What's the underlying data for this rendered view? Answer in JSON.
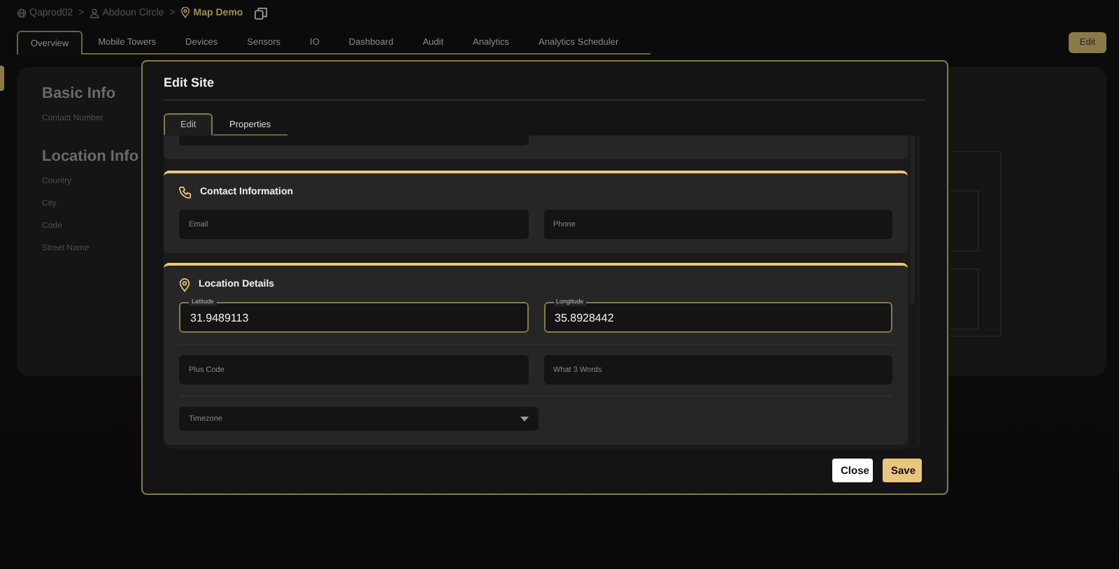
{
  "breadcrumb": [
    {
      "label": "Qaprod02",
      "current": false
    },
    {
      "label": "Abdoun Circle",
      "current": false
    },
    {
      "label": "Map Demo",
      "current": true
    }
  ],
  "breadcrumb_separator": ">",
  "tabs": [
    {
      "label": "Overview",
      "selected": true
    },
    {
      "label": "Mobile Towers",
      "selected": false
    },
    {
      "label": "Devices",
      "selected": false
    },
    {
      "label": "Sensors",
      "selected": false
    },
    {
      "label": "IO",
      "selected": false
    },
    {
      "label": "Dashboard",
      "selected": false
    },
    {
      "label": "Audit",
      "selected": false
    },
    {
      "label": "Analytics",
      "selected": false
    },
    {
      "label": "Analytics Scheduler",
      "selected": false
    }
  ],
  "edit_button": "Edit",
  "info_sections": [
    {
      "title": "Basic Info",
      "fields": [
        "Contact Number"
      ]
    },
    {
      "title": "Location Info",
      "fields": [
        "Country",
        "City",
        "Code",
        "Street Name"
      ]
    }
  ],
  "modal": {
    "title": "Edit Site",
    "tabs": [
      {
        "label": "Edit",
        "selected": true
      },
      {
        "label": "Properties",
        "selected": false
      }
    ],
    "sections": [
      {
        "title": "Contact Information",
        "rows": [
          [
            {
              "kind": "text",
              "placeholder": "Email"
            },
            {
              "kind": "text",
              "placeholder": "Phone"
            }
          ]
        ]
      },
      {
        "title": "Location Details",
        "rows": [
          [
            {
              "kind": "outlined",
              "label": "Latitude",
              "value": "31.9489113"
            },
            {
              "kind": "outlined",
              "label": "Longitude",
              "value": "35.8928442"
            }
          ],
          [
            {
              "kind": "text",
              "placeholder": "Plus Code"
            },
            {
              "kind": "text",
              "placeholder": "What 3 Words"
            }
          ],
          [
            {
              "kind": "select",
              "placeholder": "Timezone"
            }
          ]
        ]
      }
    ],
    "buttons": [
      {
        "label": "Close",
        "kind": "secondary"
      },
      {
        "label": "Save",
        "kind": "primary"
      }
    ]
  }
}
